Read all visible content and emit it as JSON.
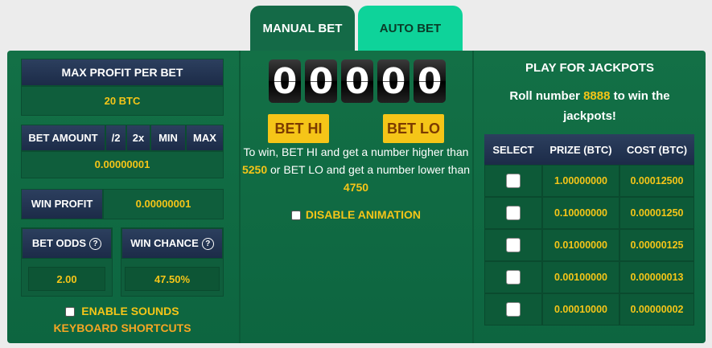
{
  "tabs": [
    {
      "label": "MANUAL BET",
      "active": true
    },
    {
      "label": "AUTO BET",
      "active": false
    }
  ],
  "left": {
    "max_profit_label": "MAX PROFIT PER BET",
    "max_profit_value": "20 BTC",
    "bet_amount_label": "BET AMOUNT",
    "bet_buttons": [
      "/2",
      "2x",
      "MIN",
      "MAX"
    ],
    "bet_amount_value": "0.00000001",
    "win_profit_label": "WIN PROFIT",
    "win_profit_value": "0.00000001",
    "bet_odds_label": "BET ODDS",
    "bet_odds_value": "2.00",
    "win_chance_label": "WIN CHANCE",
    "win_chance_value": "47.50%",
    "help_icon": "?",
    "enable_sounds_label": "ENABLE SOUNDS",
    "keyboard_shortcuts_label": "KEYBOARD SHORTCUTS"
  },
  "center": {
    "digits": [
      "0",
      "0",
      "0",
      "0",
      "0"
    ],
    "bet_hi_label": "BET HI",
    "bet_lo_label": "BET LO",
    "info_1": "To win, BET HI and get a number higher than",
    "hi_threshold": "5250",
    "info_2": "or BET LO and get a number lower than",
    "lo_threshold": "4750",
    "disable_animation_label": "DISABLE ANIMATION"
  },
  "right": {
    "title": "PLAY FOR JACKPOTS",
    "roll_prefix": "Roll number",
    "roll_number": "8888",
    "roll_suffix": "to win the jackpots!",
    "columns": [
      "SELECT",
      "PRIZE (BTC)",
      "COST (BTC)"
    ],
    "rows": [
      {
        "prize": "1.00000000",
        "cost": "0.00012500"
      },
      {
        "prize": "0.10000000",
        "cost": "0.00001250"
      },
      {
        "prize": "0.01000000",
        "cost": "0.00000125"
      },
      {
        "prize": "0.00100000",
        "cost": "0.00000013"
      },
      {
        "prize": "0.00010000",
        "cost": "0.00000002"
      }
    ]
  },
  "colors": {
    "panel_green": "#137046",
    "header_navy": "#1c2b48",
    "accent_yellow": "#f5c518",
    "tab_inactive": "#0ed39a"
  }
}
